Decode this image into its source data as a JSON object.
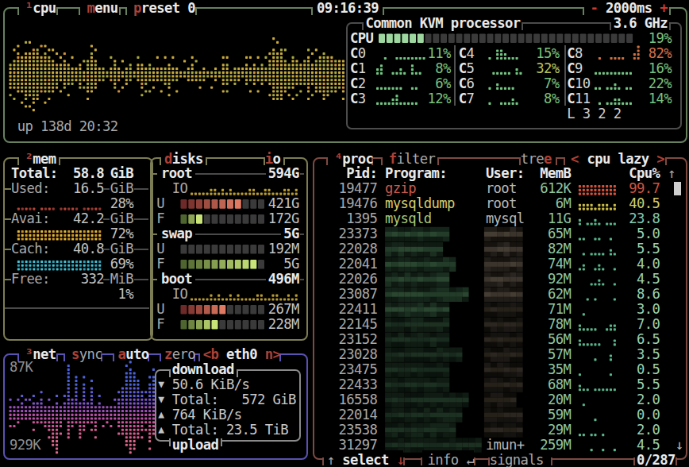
{
  "colors": {
    "bg": "#000000",
    "white": "#e9e9e9",
    "gray": "#a9a9a9",
    "dimgray": "#8f8f8f",
    "value": "#c3c3c3",
    "red": "#ba463b",
    "bright_red": "#c93b31",
    "hotkey_red": "#ad4136",
    "green": "#79c27f",
    "pale_green": "#9ad2b0",
    "mem_green": "#8cc7a1",
    "yellow": "#d3cd6e",
    "mid_green": "#b9c55c",
    "orange": "#d2714d",
    "salmon": "#cd594a",
    "cpu_border": "#67815f",
    "memdisk_border": "#7d7d55",
    "net_border": "#5a52b2",
    "proc_border": "#7d4a42",
    "panel_border": "#4c4c4c",
    "net_panel_border": "#8a8a8a",
    "meter_off": "#3a3a3a",
    "meter_on_green": "#9ed8a0",
    "scrollbar": "#cfcfcf"
  },
  "cpu": {
    "num": "¹",
    "title": "cpu",
    "menu_key": "m",
    "menu_rest": "enu",
    "preset_key": "p",
    "preset_rest": "reset 0",
    "clock": "09:16:39",
    "interval_minus": "-",
    "interval": "2000ms",
    "interval_plus": "+",
    "uptime": "up 138d 20:32",
    "model": "Common KVM processor",
    "freq": "3.6 GHz",
    "meter_label": "CPU",
    "meter_blocks": 33,
    "meter_lit": 6,
    "total_pct": "19%",
    "load_avg": "L 3 2 2",
    "cores": [
      {
        "name": "C0",
        "pct": "11%",
        "lvl": "low",
        "graph": "0010011111111"
      },
      {
        "name": "C1",
        "pct": "8%",
        "lvl": "low",
        "graph": "2300112103110"
      },
      {
        "name": "C2",
        "pct": "6%",
        "lvl": "low",
        "graph": "1111111001100"
      },
      {
        "name": "C3",
        "pct": "12%",
        "lvl": "low",
        "graph": "1111231111100"
      },
      {
        "name": "C4",
        "pct": "15%",
        "lvl": "low",
        "graph": "0103321110000"
      },
      {
        "name": "C5",
        "pct": "32%",
        "lvl": "mid",
        "graph": "0011111021000"
      },
      {
        "name": "C6",
        "pct": "7%",
        "lvl": "low",
        "graph": "0102111100000"
      },
      {
        "name": "C7",
        "pct": "8%",
        "lvl": "low",
        "graph": "0100111210000"
      },
      {
        "name": "C8",
        "pct": "82%",
        "lvl": "high",
        "graph": "01001111002400"
      },
      {
        "name": "C9",
        "pct": "16%",
        "lvl": "low",
        "graph": "1111111111000"
      },
      {
        "name": "C10",
        "pct": "22%",
        "lvl": "low",
        "graph": "1101121011000"
      },
      {
        "name": "C11",
        "pct": "14%",
        "lvl": "low",
        "graph": "0101122111000"
      }
    ],
    "graph_half_heights": [
      4,
      5,
      6,
      6,
      7,
      7,
      8,
      7,
      6,
      6,
      5,
      5,
      4,
      3,
      4,
      4,
      3,
      3,
      4,
      2,
      5,
      6,
      5,
      3,
      3,
      2,
      3,
      5,
      3,
      2,
      3,
      3,
      2,
      3,
      4,
      3,
      3,
      2,
      3,
      3,
      3,
      4,
      3,
      3,
      2,
      2,
      3,
      3,
      2,
      2,
      3,
      2,
      2,
      3,
      2,
      3,
      3,
      2,
      3,
      2,
      2,
      3,
      3,
      4,
      3,
      4,
      3,
      4,
      8,
      7,
      8,
      5,
      4,
      5,
      4,
      3,
      4,
      5,
      4,
      5,
      6,
      7,
      6,
      6,
      5,
      5,
      5
    ]
  },
  "mem": {
    "num": "²",
    "title": "mem",
    "total_label": "Total:",
    "total_value": "58.8",
    "total_unit": "GiB",
    "stats": [
      {
        "label": "Used:",
        "value": "16.5",
        "unit": "GiB",
        "pct": "28%",
        "graph": [
          1,
          1,
          1,
          1,
          1,
          0,
          1,
          1,
          1,
          1,
          0,
          1,
          1,
          1,
          1,
          1,
          0,
          1,
          1,
          1,
          1,
          1
        ],
        "color": "used"
      },
      {
        "label": "Avai:",
        "value": "42.2",
        "unit": "GiB",
        "pct": "72%",
        "graph": [
          3,
          3,
          3,
          3,
          3,
          3,
          3,
          3,
          3,
          3,
          3,
          3,
          3,
          3,
          3,
          3,
          3,
          3,
          3,
          3,
          3,
          3
        ],
        "color": "avai"
      },
      {
        "label": "Cach:",
        "value": "40.8",
        "unit": "GiB",
        "pct": "69%",
        "graph": [
          3,
          3,
          3,
          3,
          3,
          3,
          3,
          3,
          3,
          3,
          3,
          3,
          3,
          3,
          3,
          3,
          3,
          3,
          3,
          3,
          3,
          3
        ],
        "color": "cach"
      },
      {
        "label": "Free:",
        "value": "332",
        "unit": "MiB",
        "pct": "1%",
        "graph": [],
        "color": "free"
      }
    ]
  },
  "disks": {
    "title_key": "d",
    "title_rest": "isks",
    "io_key": "i",
    "io_rest": "o",
    "entries": [
      {
        "name": "root",
        "size": "594G",
        "io": [
          1,
          1,
          1,
          1,
          1,
          2,
          2,
          1,
          2,
          1,
          2,
          1,
          1,
          1,
          1,
          2,
          2,
          1,
          1,
          2,
          2,
          1,
          1,
          1,
          2,
          2,
          1,
          2
        ],
        "used": "421G",
        "free": "172G",
        "u_lit": 8,
        "f_lit": 3,
        "blocks": 11
      },
      {
        "name": "swap",
        "size": "5G",
        "io": null,
        "used": "192M",
        "free": "5G",
        "u_lit": 0,
        "f_lit": 10,
        "blocks": 11
      },
      {
        "name": "boot",
        "size": "496M",
        "io": [
          1,
          1,
          1,
          1,
          1,
          2,
          1,
          2,
          1,
          1,
          2,
          1,
          2,
          1,
          1,
          1,
          1,
          2,
          2,
          1,
          1,
          2,
          2,
          1,
          1,
          2,
          1,
          2
        ],
        "used": "267M",
        "free": "228M",
        "u_lit": 6,
        "f_lit": 5,
        "blocks": 11
      }
    ]
  },
  "net": {
    "num": "³",
    "title": "net",
    "sync_key": "s",
    "sync_rest": "ync",
    "auto_key": "a",
    "auto_rest": "uto",
    "zero_key": "z",
    "zero_rest": "ero",
    "iface_prev": "<b",
    "iface": "eth0",
    "iface_next": "n>",
    "down_scale": "87K",
    "up_scale": "929K",
    "panel_top_title": "download",
    "panel_bottom_title": "upload",
    "stats": [
      {
        "arrow": "▼",
        "text": "50.6 KiB/s"
      },
      {
        "arrow": "▼",
        "text": "Total:   572 GiB"
      },
      {
        "arrow": "▲",
        "text": "764 KiB/s"
      },
      {
        "arrow": "▲",
        "text": "Total: 23.5 TiB"
      }
    ],
    "graph_down": [
      2,
      2,
      2,
      3,
      2,
      2,
      3,
      3,
      4,
      2,
      2,
      2,
      3,
      2,
      3,
      13,
      4,
      10,
      3,
      8,
      3,
      7,
      2,
      3,
      2,
      2,
      2,
      2,
      4,
      7,
      11,
      12,
      11,
      9,
      6,
      4,
      8,
      10
    ],
    "graph_up": [
      2,
      2,
      3,
      2,
      2,
      2,
      3,
      3,
      3,
      4,
      5,
      9,
      11,
      4,
      2,
      7,
      4,
      3,
      7,
      5,
      3,
      3,
      5,
      2,
      2,
      3,
      2,
      2,
      4,
      6,
      9,
      11,
      10,
      7,
      5,
      3,
      8,
      6
    ]
  },
  "proc": {
    "num": "⁴",
    "title": "proc",
    "filter_key": "f",
    "filter_rest": "ilter",
    "tree_pre": "tre",
    "tree_key": "e",
    "sort_left": "<",
    "sort_label": "cpu lazy",
    "sort_right": ">",
    "header": {
      "pid": "Pid:",
      "program": "Program:",
      "user": "User:",
      "mem": "MemB",
      "cpu": "Cpu%",
      "sort_arrow": "↑"
    },
    "rows": [
      {
        "pid": "19477",
        "program": "gzip",
        "user": "root",
        "mem": "612K",
        "cpu": "99.7",
        "pc": "red",
        "cc": "red",
        "graph": "3333333333",
        "gc": "red"
      },
      {
        "pid": "19476",
        "program": "mysqldump",
        "user": "root",
        "mem": "6M",
        "cpu": "40.5",
        "pc": "yellow",
        "cc": "yellow",
        "graph": "2222122212",
        "gc": "yellow"
      },
      {
        "pid": "1395",
        "program": "mysqld",
        "user": "mysql",
        "mem": "11G",
        "cpu": "23.8",
        "pc": "green",
        "cc": "cyan",
        "graph": "2011210111",
        "gc": "green"
      },
      {
        "pid": "23373",
        "mem": "65M",
        "cpu": "5.0",
        "cc": "pale",
        "blur_w": 78,
        "ublur_w": 49,
        "graph": "1100110010",
        "gc": "green"
      },
      {
        "pid": "22028",
        "mem": "82M",
        "cpu": "5.5",
        "cc": "pale",
        "blur_w": 75,
        "ublur_w": 49,
        "graph": "0101111021",
        "gc": "green"
      },
      {
        "pid": "22041",
        "mem": "74M",
        "cpu": "4.0",
        "cc": "pale",
        "blur_w": 88,
        "ublur_w": 49,
        "graph": "1200121001",
        "gc": "green"
      },
      {
        "pid": "22026",
        "mem": "92M",
        "cpu": "4.5",
        "cc": "pale",
        "blur_w": 85,
        "ublur_w": 49,
        "graph": "0001121001",
        "gc": "green"
      },
      {
        "pid": "23087",
        "mem": "62M",
        "cpu": "8.6",
        "cc": "pale",
        "blur_w": 105,
        "ublur_w": 49,
        "graph": "0010100001",
        "gc": "green"
      },
      {
        "pid": "22411",
        "mem": "71M",
        "cpu": "3.0",
        "cc": "pale",
        "blur_w": 78,
        "ublur_w": 49,
        "graph": "0100000000",
        "gc": "green"
      },
      {
        "pid": "22145",
        "mem": "78M",
        "cpu": "7.0",
        "cc": "pale",
        "blur_w": 85,
        "ublur_w": 49,
        "graph": "2111100122",
        "gc": "green"
      },
      {
        "pid": "23152",
        "mem": "56M",
        "cpu": "6.5",
        "cc": "pale",
        "blur_w": 78,
        "ublur_w": 49,
        "graph": "2111110002",
        "gc": "green"
      },
      {
        "pid": "23028",
        "mem": "57M",
        "cpu": "3.5",
        "cc": "pale",
        "blur_w": 95,
        "ublur_w": 49,
        "graph": "0000100020",
        "gc": "green"
      },
      {
        "pid": "23475",
        "mem": "35M",
        "cpu": "0.5",
        "cc": "pale",
        "blur_w": 85,
        "ublur_w": 49,
        "graph": "1000000010",
        "gc": "green"
      },
      {
        "pid": "22433",
        "mem": "68M",
        "cpu": "5.5",
        "cc": "pale",
        "blur_w": 78,
        "ublur_w": 49,
        "graph": "2110111111",
        "gc": "green"
      },
      {
        "pid": "16558",
        "mem": "20M",
        "cpu": "2.0",
        "cc": "pale",
        "blur_w": 102,
        "ublur_w": 39,
        "graph": "0100000000",
        "gc": "green"
      },
      {
        "pid": "22014",
        "mem": "59M",
        "cpu": "0.0",
        "cc": "pale",
        "blur_w": 95,
        "ublur_w": 49,
        "graph": "0000100000",
        "gc": "green"
      },
      {
        "pid": "23538",
        "mem": "29M",
        "cpu": "2.0",
        "cc": "pale",
        "blur_w": 88,
        "ublur_w": 49,
        "graph": "1101101000",
        "gc": "green"
      },
      {
        "pid": "31297",
        "user": "imun+",
        "mem": "259M",
        "cpu": "4.5",
        "cc": "pale",
        "blur_w": 122,
        "graph": "0001001001",
        "gc": "green"
      }
    ],
    "footer": {
      "up": "↑",
      "select": "select",
      "down": "↓",
      "info": "info",
      "enter": "↵",
      "signals": "signals",
      "count": "0/287",
      "scroll_down": "↓"
    }
  }
}
